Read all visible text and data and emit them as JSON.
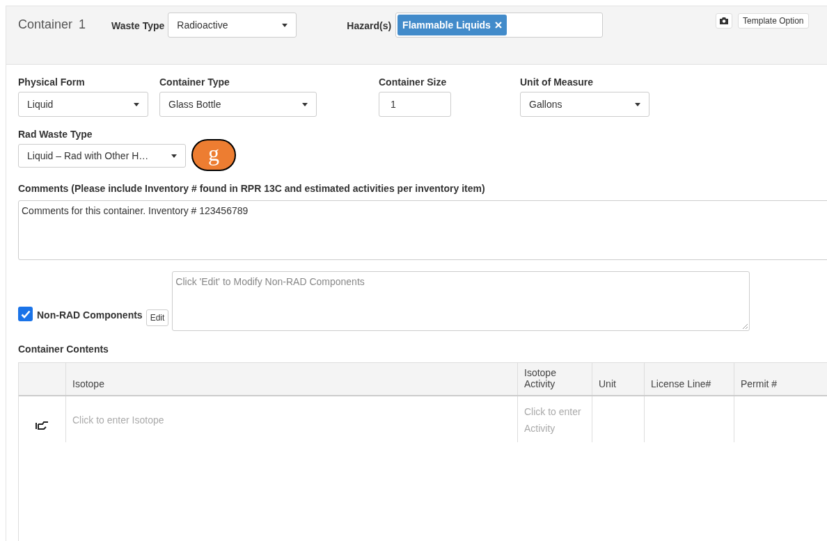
{
  "header": {
    "title": "Container",
    "number": "1",
    "waste_type": {
      "label": "Waste Type",
      "value": "Radioactive"
    },
    "hazards": {
      "label": "Hazard(s)",
      "tags": [
        "Flammable Liquids"
      ]
    },
    "template_button": "Template Option"
  },
  "fields": [
    {
      "label": "Physical Form",
      "kind": "select",
      "value": "Liquid"
    },
    {
      "label": "Container Type",
      "kind": "select",
      "value": "Glass Bottle"
    },
    {
      "label": "Container Size",
      "kind": "input",
      "value": "1"
    },
    {
      "label": "Unit of Measure",
      "kind": "select",
      "value": "Gallons"
    }
  ],
  "rad_waste_type": {
    "label": "Rad Waste Type",
    "value": "Liquid – Rad with Other H…"
  },
  "callout": "g",
  "comments": {
    "label": "Comments (Please include Inventory # found in RPR 13C and estimated activities per inventory item)",
    "value": "Comments for this container. Inventory # 123456789"
  },
  "non_rad": {
    "label": "Non-RAD Components",
    "checked": true,
    "edit_button": "Edit",
    "placeholder": "Click 'Edit' to Modify Non-RAD Components"
  },
  "contents": {
    "title": "Container Contents",
    "columns": [
      "Isotope",
      "Isotope Activity",
      "Unit",
      "License Line#",
      "Permit #"
    ],
    "rows": [
      {
        "cells": [
          "Click to enter Isotope",
          "Click to enter Activity",
          "",
          "",
          ""
        ]
      }
    ]
  }
}
